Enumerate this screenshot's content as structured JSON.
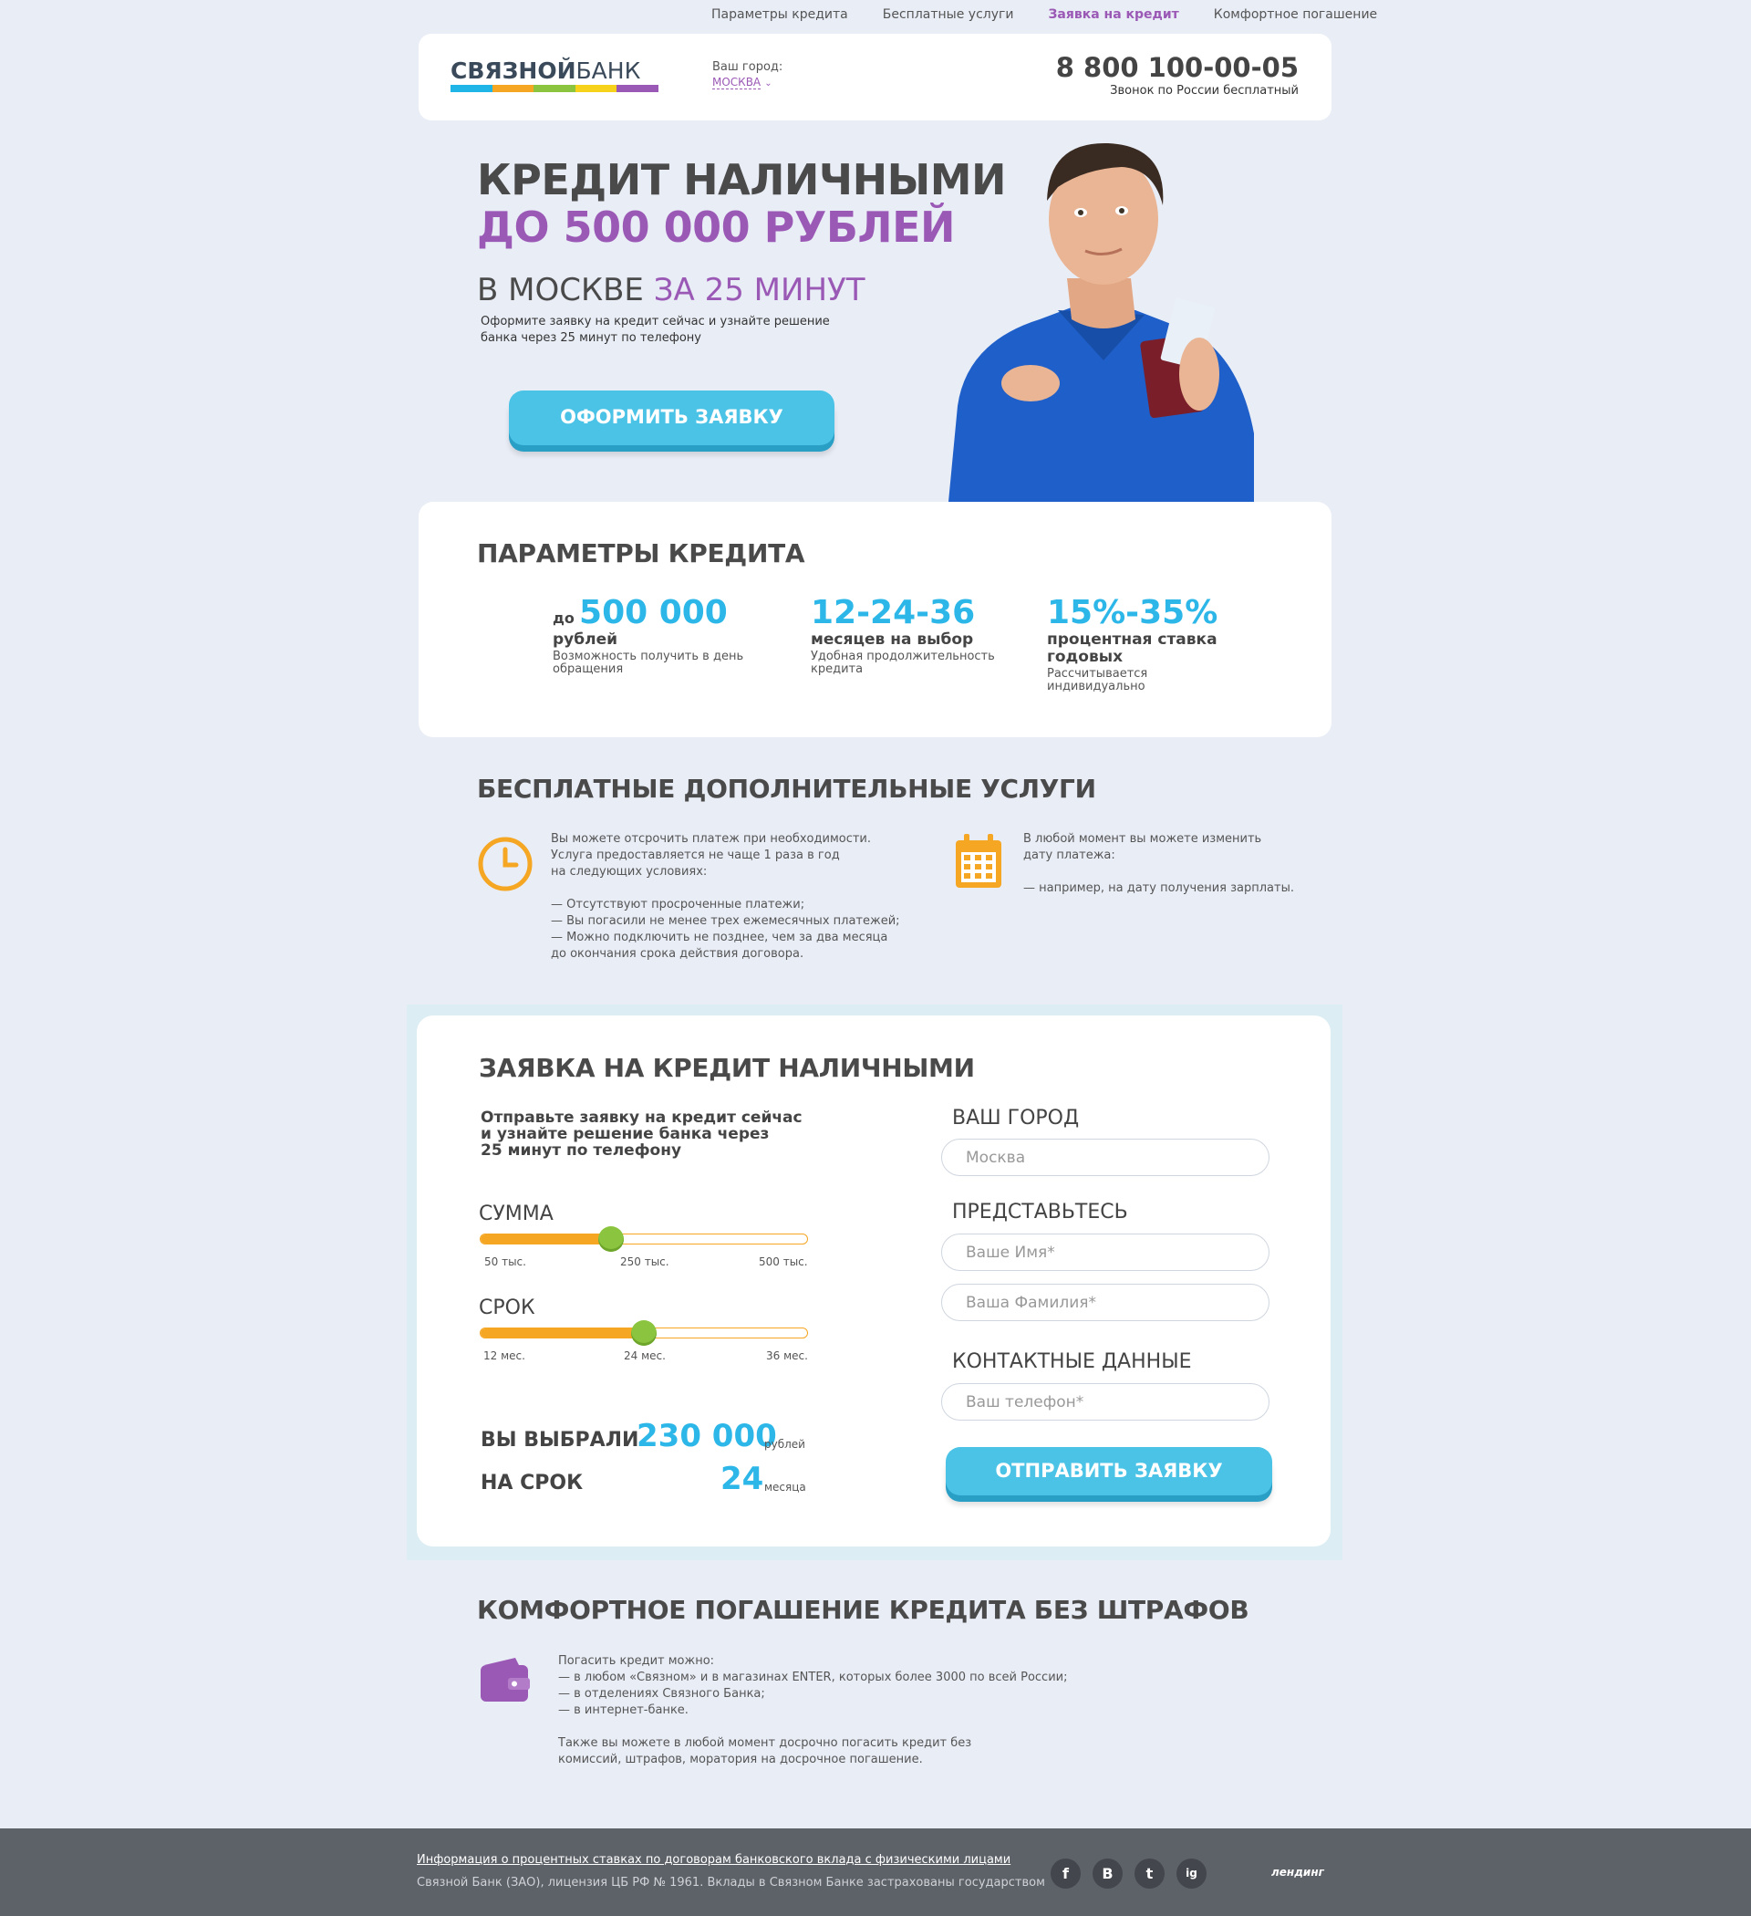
{
  "topnav": {
    "items": [
      "Параметры кредита",
      "Бесплатные услуги",
      "Заявка на кредит",
      "Комфортное погашение"
    ],
    "active_index": 2
  },
  "header": {
    "logo_main": "СВЯЗНОЙ",
    "logo_bank": "БАНК",
    "logo_colors": [
      "#1fb5e6",
      "#f5a623",
      "#8bc53f",
      "#f7d21b",
      "#9b59b6"
    ],
    "city_label": "Ваш город:",
    "city_value": "МОСКВА",
    "phone": "8 800 100-00-05",
    "phone_note": "Звонок по России бесплатный"
  },
  "hero": {
    "title_line1": "КРЕДИТ НАЛИЧНЫМИ",
    "title_line2": "ДО 500 000 РУБЛЕЙ",
    "sub_plain": "В МОСКВЕ ",
    "sub_accent": "ЗА 25 МИНУТ",
    "description": "Оформите заявку на кредит сейчас и узнайте решение банка через 25 минут по телефону",
    "button": "ОФОРМИТЬ ЗАЯВКУ"
  },
  "params": {
    "title": "ПАРАМЕТРЫ КРЕДИТА",
    "items": [
      {
        "pre": "до",
        "big": "500 000",
        "unit": "рублей",
        "desc": "Возможность получить в день обращения"
      },
      {
        "pre": "",
        "big": "12-24-36",
        "unit": "месяцев на выбор",
        "desc": "Удобная продолжительность кредита"
      },
      {
        "pre": "",
        "big": "15%-35%",
        "unit": "процентная ставка годовых",
        "desc": "Рассчитывается индивидуально"
      }
    ]
  },
  "services": {
    "title": "БЕСПЛАТНЫЕ ДОПОЛНИТЕЛЬНЫЕ УСЛУГИ",
    "left_text": "Вы можете отсрочить платеж при необходимости.\nУслуга предоставляется не чаще 1 раза в год\nна следующих условиях:\n\n— Отсутствуют просроченные платежи;\n— Вы погасили не менее трех ежемесячных платежей;\n— Можно подключить не позднее, чем за два месяца\nдо окончания срока действия договора.",
    "right_text": "В любой момент вы можете изменить\nдату платежа:\n\n— например, на дату получения зарплаты.",
    "left_icon": "clock-icon",
    "right_icon": "calendar-icon"
  },
  "form": {
    "title": "ЗАЯВКА НА КРЕДИТ НАЛИЧНЫМИ",
    "lead": "Отправьте заявку на кредит сейчас\nи узнайте решение банка через\n25 минут по телефону",
    "sum_label": "СУММА",
    "sum_ticks": [
      "50 тыс.",
      "250 тыс.",
      "500 тыс."
    ],
    "sum_level": 0.4,
    "term_label": "СРОК",
    "term_ticks": [
      "12 мес.",
      "24 мес.",
      "36 мес."
    ],
    "term_level": 0.5,
    "chosen_label": "ВЫ ВЫБРАЛИ",
    "chosen_value": "230 000",
    "chosen_unit": "рублей",
    "term_summary_label": "НА СРОК",
    "term_summary_value": "24",
    "term_summary_unit": "месяца",
    "city_heading": "ВАШ ГОРОД",
    "city_placeholder": "Москва",
    "intro_heading": "ПРЕДСТАВЬТЕСЬ",
    "name_placeholder": "Ваше Имя*",
    "surname_placeholder": "Ваша Фамилия*",
    "contact_heading": "КОНТАКТНЫЕ ДАННЫЕ",
    "phone_placeholder": "Ваш телефон*",
    "submit": "ОТПРАВИТЬ ЗАЯВКУ"
  },
  "comfort": {
    "title": "КОМФОРТНОЕ ПОГАШЕНИЕ КРЕДИТА БЕЗ ШТРАФОВ",
    "text": "Погасить кредит можно:\n— в любом «Связном» и в магазинах ENTER, которых более 3000 по всей России;\n— в отделениях Связного Банка;\n— в интернет-банке.\n\nТакже вы можете в любой момент досрочно погасить кредит без\nкомиссий, штрафов, моратория на досрочное погашение.",
    "icon": "wallet-icon"
  },
  "footer": {
    "link": "Информация о процентных ставках по договорам банковского вклада с физическими лицами",
    "note": "Связной Банк (ЗАО), лицензия ЦБ РФ № 1961. Вклады в Связном Банке застрахованы государством",
    "social": [
      "f",
      "В",
      "t",
      "ig"
    ],
    "landing_logo": "лендинг"
  },
  "colors": {
    "accent_purple": "#9b59b6",
    "accent_blue": "#2cb7e8",
    "button_blue": "#4bc3e6",
    "slider_orange": "#f5a623",
    "knob_green": "#8bc53f"
  }
}
